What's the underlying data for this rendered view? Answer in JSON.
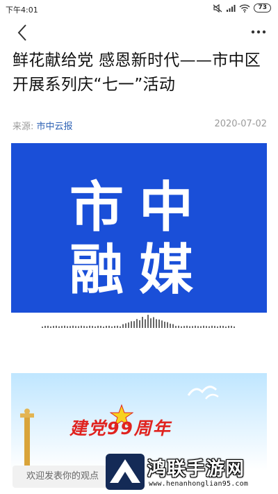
{
  "status": {
    "time": "下午4:01",
    "battery": "73"
  },
  "article": {
    "title": "鲜花献给党 感恩新时代——市中区开展系列庆“七一”活动",
    "source_label": "来源:",
    "source_name": "市中云报",
    "date": "2020-07-02"
  },
  "logo": {
    "line1": "市中",
    "line2": "融媒",
    "bg_color": "#1a4fd8"
  },
  "banner": {
    "text": "建党99周年"
  },
  "comment": {
    "placeholder": "欢迎发表你的观点"
  },
  "watermark": {
    "title": "鸿联手游网",
    "url": "www.henanhonglian95.com"
  }
}
